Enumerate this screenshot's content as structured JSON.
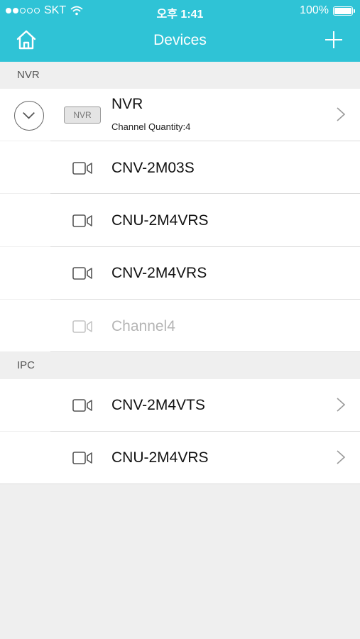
{
  "status_bar": {
    "carrier": "SKT",
    "time": "오후 1:41",
    "battery": "100%"
  },
  "nav": {
    "title": "Devices"
  },
  "sections": {
    "nvr": {
      "header": "NVR",
      "device": {
        "badge": "NVR",
        "name": "NVR",
        "subtitle": "Channel Quantity:4"
      },
      "channels": [
        {
          "label": "CNV-2M03S"
        },
        {
          "label": "CNU-2M4VRS"
        },
        {
          "label": "CNV-2M4VRS"
        },
        {
          "label": "Channel4"
        }
      ]
    },
    "ipc": {
      "header": "IPC",
      "devices": [
        {
          "label": "CNV-2M4VTS"
        },
        {
          "label": "CNU-2M4VRS"
        }
      ]
    }
  },
  "icons": {
    "home": "home-icon",
    "add": "plus-icon",
    "camera": "video-camera-icon",
    "chevron": "chevron-right-icon",
    "expand": "chevron-down-icon"
  },
  "colors": {
    "header_bg": "#2fc3d6",
    "page_bg": "#efefef",
    "disabled_text": "#b5b5b5"
  }
}
